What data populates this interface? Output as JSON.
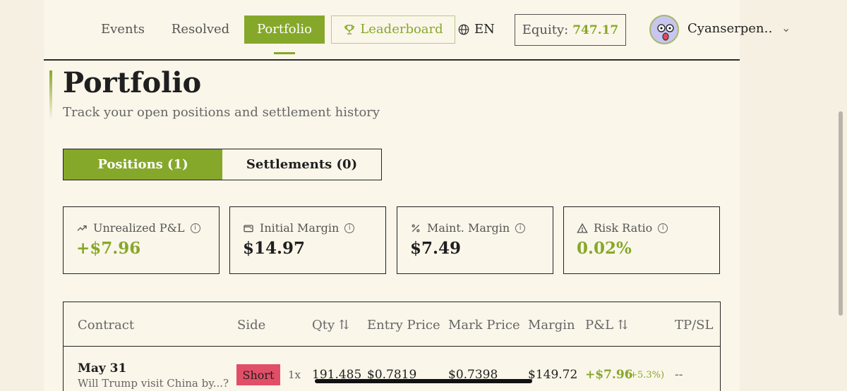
{
  "nav": {
    "events": "Events",
    "resolved": "Resolved",
    "portfolio": "Portfolio",
    "leaderboard": "Leaderboard",
    "language": "EN",
    "equity_label": "Equity:",
    "equity_value": "747.17",
    "username": "Cyanserpen…"
  },
  "header": {
    "title": "Portfolio",
    "subtitle": "Track your open positions and settlement history"
  },
  "tabs": [
    {
      "label": "Positions (1)",
      "active": true
    },
    {
      "label": "Settlements (0)",
      "active": false
    }
  ],
  "stats": [
    {
      "label": "Unrealized P&L",
      "value": "+$7.96",
      "icon": "trend-up-icon"
    },
    {
      "label": "Initial Margin",
      "value": "$14.97",
      "icon": "wallet-icon"
    },
    {
      "label": "Maint. Margin",
      "value": "$7.49",
      "icon": "percent-icon"
    },
    {
      "label": "Risk Ratio",
      "value": "0.02%",
      "icon": "warning-icon"
    }
  ],
  "table": {
    "headers": {
      "contract": "Contract",
      "side": "Side",
      "qty": "Qty",
      "entry": "Entry Price",
      "mark": "Mark Price",
      "margin": "Margin",
      "pnl": "P&L",
      "tpsl": "TP/SL"
    },
    "rows": [
      {
        "date": "May 31",
        "question": "Will Trump visit China by...?",
        "side": "Short",
        "leverage": "1x",
        "qty": "191.485",
        "entry": "$0.7819",
        "mark": "$0.7398",
        "margin": "$149.72",
        "pnl": "+$7.96",
        "pnl_pct": "(+5.3%)",
        "tpsl": "--"
      }
    ]
  },
  "colors": {
    "accent": "#86a82a",
    "short": "#e14e68",
    "background": "#f6f0e2"
  }
}
